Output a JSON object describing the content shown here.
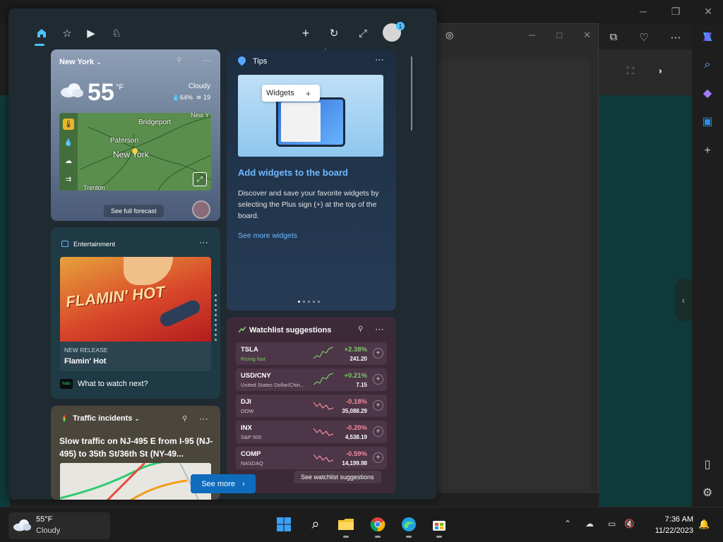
{
  "header": {
    "nav": [
      {
        "name": "home-icon",
        "active": true
      },
      {
        "name": "star-icon",
        "active": false
      },
      {
        "name": "play-icon",
        "active": false
      },
      {
        "name": "chess-icon",
        "active": false
      }
    ],
    "actions": [
      "plus-icon",
      "refresh-icon",
      "expand-icon"
    ],
    "avatar_badge": "1"
  },
  "weather": {
    "city": "New York",
    "temperature": "55",
    "unit": "°F",
    "condition": "Cloudy",
    "humidity": "64%",
    "wind": "19",
    "map_labels": [
      "Bridgeport",
      "Paterson",
      "New York",
      "New Y",
      "Trenton"
    ],
    "forecast_button": "See full forecast"
  },
  "tips": {
    "title": "Tips",
    "hero_pill": "Widgets",
    "heading": "Add widgets to the board",
    "body": "Discover and save your favorite widgets by selecting the Plus sign (+) at the top of the board.",
    "link": "See more widgets",
    "page_index": 1,
    "page_count": 5
  },
  "entertainment": {
    "title": "Entertainment",
    "poster_text": "FLAMIN' HOT",
    "badge": "NEW RELEASE",
    "name": "Flamin' Hot",
    "provider": "hulu",
    "next": "What to watch next?"
  },
  "watchlist": {
    "title": "Watchlist suggestions",
    "see_more": "See watchlist suggestions",
    "stocks": [
      {
        "symbol": "TSLA",
        "sub": "Rising fast",
        "pct": "+2.38%",
        "value": "241.20",
        "up": true
      },
      {
        "symbol": "USD/CNY",
        "sub": "United States Dollar/Chin...",
        "pct": "+0.21%",
        "value": "7.15",
        "up": true
      },
      {
        "symbol": "DJI",
        "sub": "DOW",
        "pct": "-0.18%",
        "value": "35,088.29",
        "up": false
      },
      {
        "symbol": "INX",
        "sub": "S&P 500",
        "pct": "-0.20%",
        "value": "4,538.19",
        "up": false
      },
      {
        "symbol": "COMP",
        "sub": "NASDAQ",
        "pct": "-0.59%",
        "value": "14,199.98",
        "up": false
      }
    ]
  },
  "traffic": {
    "title": "Traffic incidents",
    "body": "Slow traffic on NJ-495 E from I-95 (NJ-495) to 35th St/36th St (NY-49..."
  },
  "see_more_button": "See more",
  "taskbar": {
    "weather_temp": "55°F",
    "weather_cond": "Cloudy",
    "time": "7:36 AM",
    "date": "11/22/2023"
  },
  "colors": {
    "accent": "#4cc2ff",
    "link": "#70b8ff",
    "up": "#7ec96a",
    "down": "#f28c9c",
    "see_more_bg": "#0f6cbd"
  }
}
